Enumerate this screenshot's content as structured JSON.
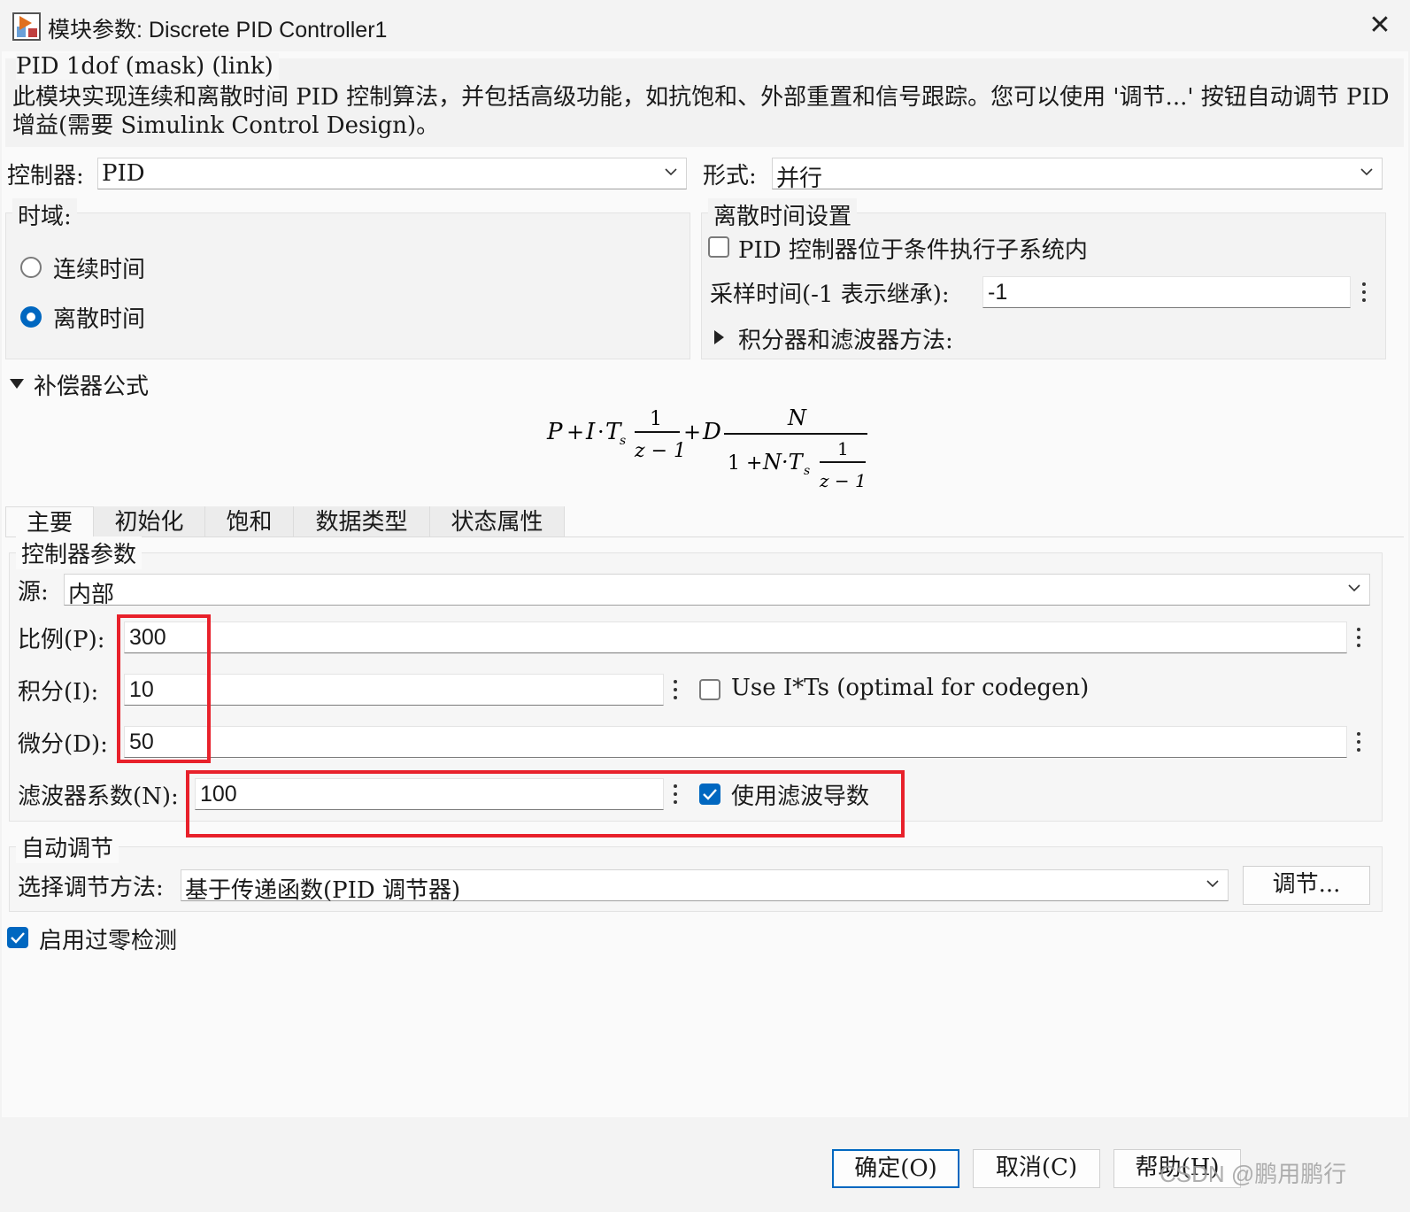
{
  "window": {
    "title": "模块参数: Discrete PID Controller1",
    "close_icon": "close-icon"
  },
  "description": {
    "mask_title": "PID 1dof (mask) (link)",
    "text": "此模块实现连续和离散时间 PID 控制算法，并包括高级功能，如抗饱和、外部重置和信号跟踪。您可以使用 '调节...' 按钮自动调节 PID 增益(需要 Simulink Control Design)。"
  },
  "controller": {
    "label": "控制器:",
    "value": "PID"
  },
  "form": {
    "label": "形式:",
    "value": "并行"
  },
  "time_domain": {
    "legend": "时域:",
    "options": [
      {
        "label": "连续时间",
        "selected": false
      },
      {
        "label": "离散时间",
        "selected": true
      }
    ]
  },
  "discrete_settings": {
    "legend": "离散时间设置",
    "conditional_label": "PID 控制器位于条件执行子系统内",
    "conditional_checked": false,
    "sample_time_label": "采样时间(-1 表示继承):",
    "sample_time_value": "-1",
    "integrator_label": "积分器和滤波器方法:"
  },
  "compensator": {
    "label": "补偿器公式"
  },
  "formula": {
    "P": "P",
    "plus": "+",
    "I": "I",
    "dot": "·",
    "Ts": "T",
    "s": "s",
    "one": "1",
    "z_minus_1": "z − 1",
    "D": "D",
    "N": "N",
    "one_plus": "1 + ",
    "NT": "N·T"
  },
  "tabs": [
    "主要",
    "初始化",
    "饱和",
    "数据类型",
    "状态属性"
  ],
  "active_tab": 0,
  "controller_params": {
    "legend": "控制器参数",
    "source_label": "源:",
    "source_value": "内部",
    "p_label": "比例(P):",
    "p_value": "300",
    "i_label": "积分(I):",
    "i_value": "10",
    "use_its_label": "Use I*Ts (optimal for codegen)",
    "use_its_checked": false,
    "d_label": "微分(D):",
    "d_value": "50",
    "n_label": "滤波器系数(N):",
    "n_value": "100",
    "filter_label": "使用滤波导数",
    "filter_checked": true
  },
  "autotune": {
    "legend": "自动调节",
    "method_label": "选择调节方法:",
    "method_value": "基于传递函数(PID 调节器)",
    "tune_button": "调节..."
  },
  "zero_crossing": {
    "label": "启用过零检测",
    "checked": true
  },
  "buttons": {
    "ok": "确定(O)",
    "cancel": "取消(C)",
    "help": "帮助(H)"
  },
  "watermark": "CSDN @鹏用鹏行",
  "accent_color": "#0067c0",
  "highlight_color": "#e8212b"
}
